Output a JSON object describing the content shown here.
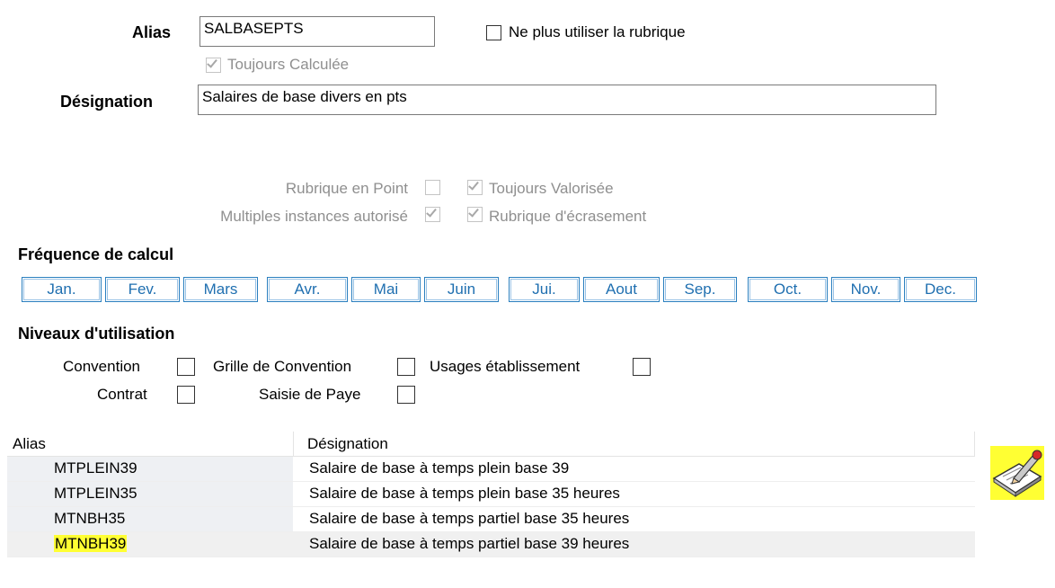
{
  "form": {
    "alias_label": "Alias",
    "alias_value": "SALBASEPTS",
    "no_longer_use_label": "Ne plus utiliser la rubrique",
    "always_calculated_label": "Toujours Calculée",
    "designation_label": "Désignation",
    "designation_value": "Salaires de base divers en pts"
  },
  "options": {
    "point_rubric_label": "Rubrique en Point",
    "always_valued_label": "Toujours Valorisée",
    "multiple_instances_label": "Multiples instances autorisé",
    "override_rubric_label": "Rubrique d'écrasement"
  },
  "frequency": {
    "title": "Fréquence de calcul",
    "months": [
      "Jan.",
      "Fev.",
      "Mars",
      "Avr.",
      "Mai",
      "Juin",
      "Jui.",
      "Aout",
      "Sep.",
      "Oct.",
      "Nov.",
      "Dec."
    ]
  },
  "levels": {
    "title": "Niveaux d'utilisation",
    "convention": "Convention",
    "convention_grid": "Grille de Convention",
    "establishment_usage": "Usages établissement",
    "contract": "Contrat",
    "payroll_entry": "Saisie de Paye"
  },
  "grid": {
    "columns": [
      "Alias",
      "Désignation"
    ],
    "rows": [
      {
        "alias": "MTPLEIN39",
        "designation": "Salaire de base à temps plein base 39"
      },
      {
        "alias": "MTPLEIN35",
        "designation": "Salaire de base à temps plein base 35 heures"
      },
      {
        "alias": "MTNBH35",
        "designation": "Salaire de base à temps partiel base 35 heures"
      },
      {
        "alias": "MTNBH39",
        "designation": "Salaire de base à temps partiel base 39 heures"
      }
    ]
  },
  "icons": {
    "edit": "notepad-pencil-icon"
  },
  "colors": {
    "month_border": "#2a7fbf",
    "month_text": "#1f6fb0",
    "highlight": "#ffff33"
  }
}
